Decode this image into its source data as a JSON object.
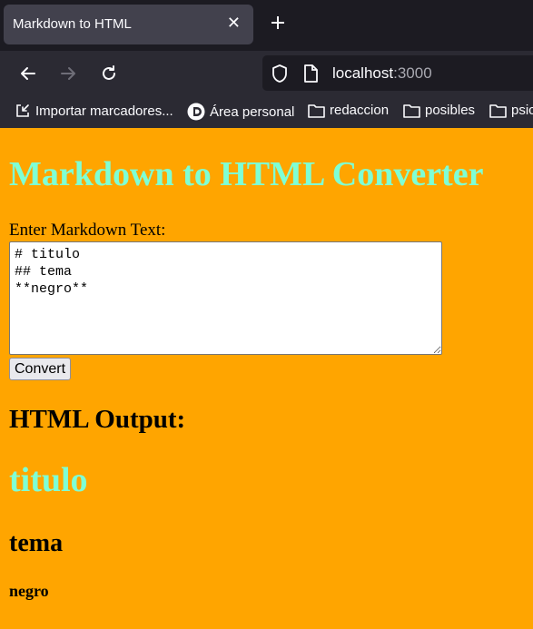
{
  "browser": {
    "tab_title": "Markdown to HTML",
    "tab_close": "✕",
    "url_host": "localhost",
    "url_port": ":3000",
    "bookmarks": [
      {
        "label": "Importar marcadores...",
        "icon": "import-icon"
      },
      {
        "label": "Área personal",
        "icon": "site-logo-icon"
      },
      {
        "label": "redaccion",
        "icon": "folder-icon"
      },
      {
        "label": "posibles",
        "icon": "folder-icon"
      },
      {
        "label": "psic",
        "icon": "folder-icon"
      }
    ]
  },
  "page": {
    "title": "Markdown to HTML Converter",
    "input_label": "Enter Markdown Text:",
    "markdown_value": "# titulo\n## tema\n**negro**",
    "convert_label": "Convert",
    "output_heading": "HTML Output:",
    "output": {
      "h1": "titulo",
      "h2": "tema",
      "strong": "negro"
    }
  },
  "colors": {
    "page_bg": "#ffa500",
    "heading_accent": "#7fffd4",
    "chrome_bg": "#1c1b22",
    "toolbar_bg": "#2b2a33"
  }
}
